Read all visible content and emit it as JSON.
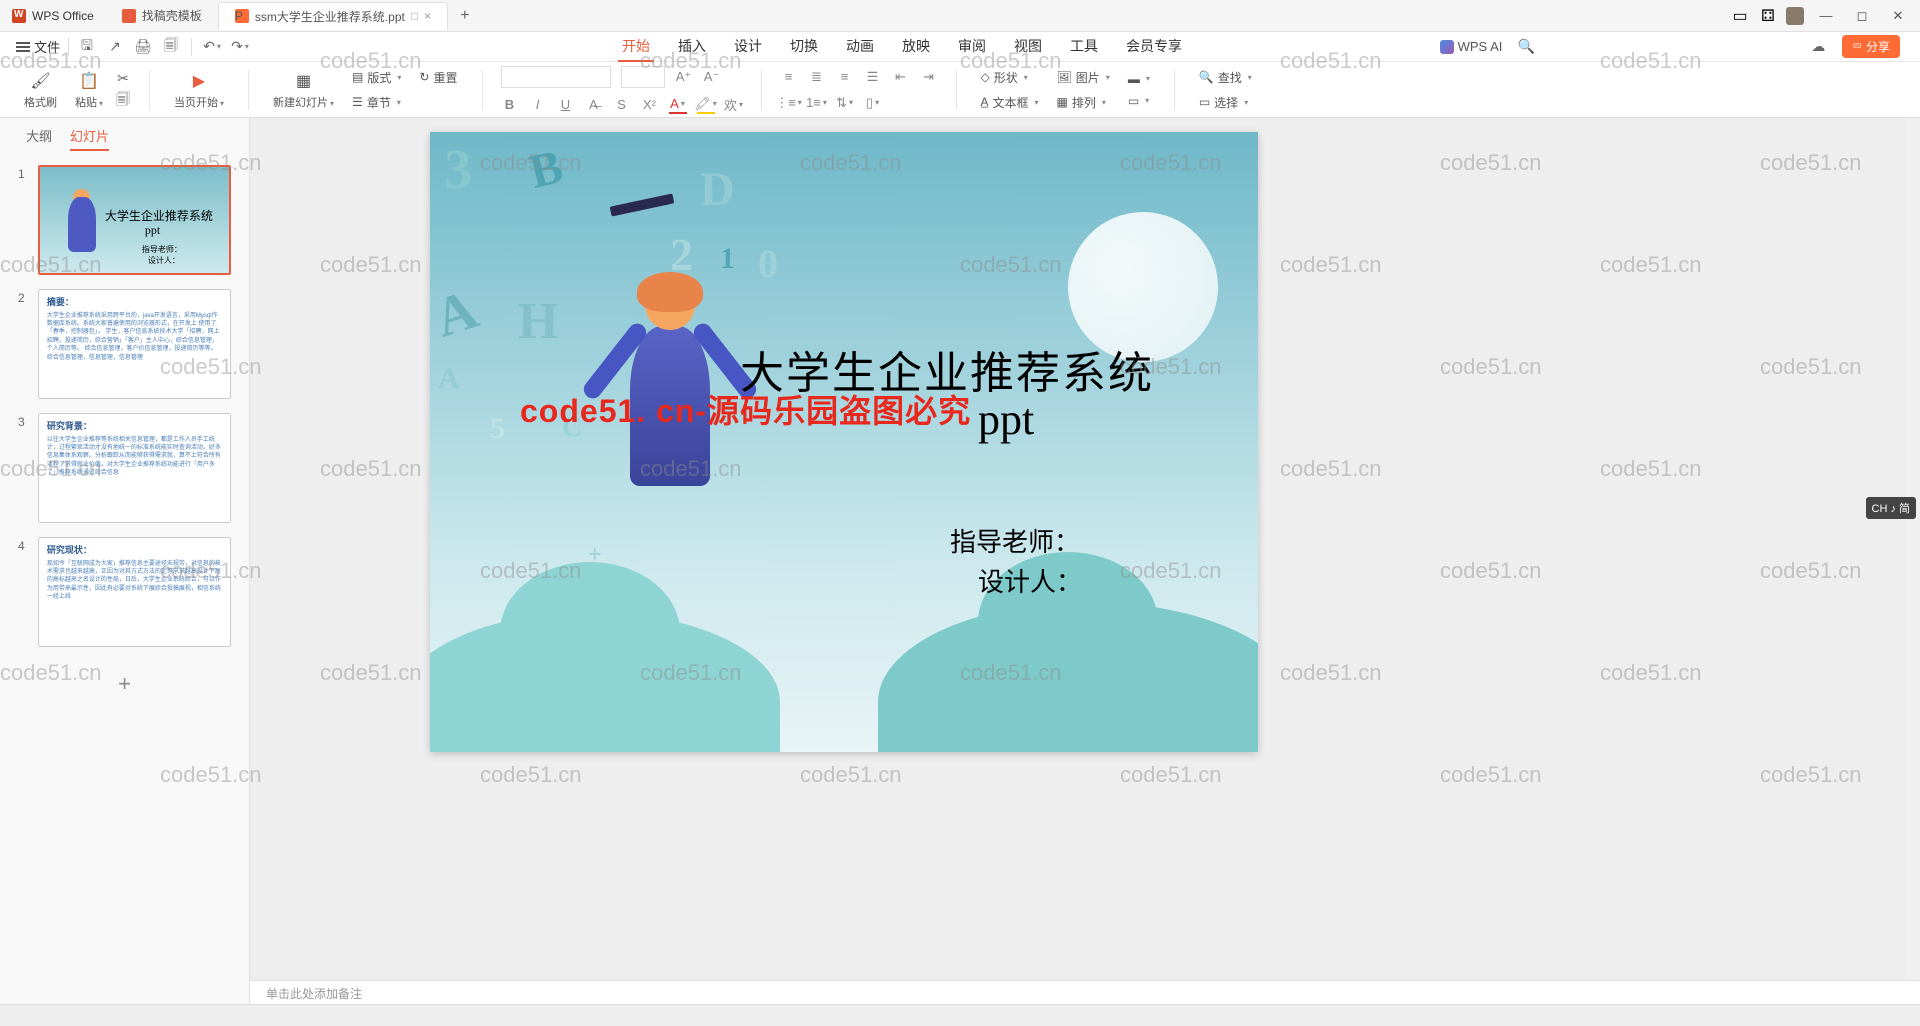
{
  "app": {
    "name": "WPS Office"
  },
  "tabs": [
    {
      "label": "找稿壳模板",
      "active": false
    },
    {
      "label": "ssm大学生企业推荐系统.ppt",
      "active": true,
      "badge": "□"
    }
  ],
  "file_menu": "文件",
  "menu": {
    "items": [
      "开始",
      "插入",
      "设计",
      "切换",
      "动画",
      "放映",
      "审阅",
      "视图",
      "工具",
      "会员专享"
    ],
    "active": "开始",
    "wps_ai": "WPS AI",
    "share": "分享"
  },
  "ribbon": {
    "format_painter": "格式刷",
    "paste": "粘贴",
    "from_current": "当页开始",
    "new_slide": "新建幻灯片",
    "layout": "版式",
    "sections": "章节",
    "reset": "重置",
    "shape": "形状",
    "picture": "图片",
    "textbox": "文本框",
    "arrange": "排列",
    "find": "查找",
    "select": "选择"
  },
  "sidepanel": {
    "tabs": [
      "大纲",
      "幻灯片"
    ],
    "active": "幻灯片",
    "slides": [
      {
        "n": 1,
        "type": "title"
      },
      {
        "n": 2,
        "type": "text",
        "heading": "摘要："
      },
      {
        "n": 3,
        "type": "text",
        "heading": "研究背景："
      },
      {
        "n": 4,
        "type": "text",
        "heading": "研究现状："
      }
    ],
    "add": "+"
  },
  "slide": {
    "title": "大学生企业推荐系统",
    "sub": "ppt",
    "teacher": "指导老师：",
    "designer": "设计人：",
    "watermark_red": "code51. cn-源码乐园盗图必究"
  },
  "thumb1": {
    "title": "大学生企业推荐系统",
    "sub": "ppt",
    "t1": "指导老师：",
    "t2": "设计人："
  },
  "notes": {
    "placeholder": "单击此处添加备注"
  },
  "ime": {
    "label": "CH ♪ 简"
  },
  "watermark": "code51.cn"
}
